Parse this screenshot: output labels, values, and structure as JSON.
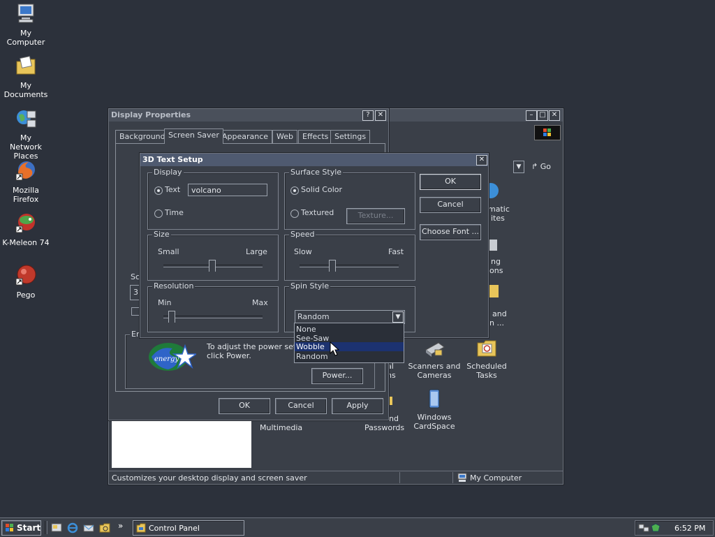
{
  "desktop": {
    "icons": [
      {
        "label": "My Computer"
      },
      {
        "label": "My Documents"
      },
      {
        "label": "My Network Places"
      },
      {
        "label": "Mozilla Firefox"
      },
      {
        "label": "K-Meleon 74"
      },
      {
        "label": "Pego"
      }
    ]
  },
  "control_panel": {
    "go_label": "Go",
    "items_partial": [
      "matic",
      "ites",
      "ng",
      "ons",
      "and",
      "n ..."
    ],
    "items": [
      {
        "label": "Scanners and Cameras"
      },
      {
        "label": "Scheduled Tasks"
      },
      {
        "label": "Windows CardSpace"
      }
    ],
    "partial_labels": [
      "al",
      "ns",
      "nd",
      "Passwords",
      "Multimedia"
    ],
    "status_text": "Customizes your desktop display and screen saver",
    "status_zone": "My Computer"
  },
  "display_properties": {
    "title": "Display Properties",
    "help_glyph": "?",
    "close_glyph": "✕",
    "tabs": [
      "Background",
      "Screen Saver",
      "Appearance",
      "Web",
      "Effects",
      "Settings"
    ],
    "screensaver_group_partial": "Sc",
    "screensaver_combo_partial": "3I",
    "energy_group_partial": "En",
    "energy_text_line1": "To adjust the power setting",
    "energy_text_line2": "click Power.",
    "power_button": "Power...",
    "ok": "OK",
    "cancel": "Cancel",
    "apply": "Apply"
  },
  "setup_dialog": {
    "title": "3D Text Setup",
    "close_glyph": "✕",
    "display_group": "Display",
    "text_radio": "Text",
    "text_value": "volcano",
    "time_radio": "Time",
    "surface_group": "Surface Style",
    "solid_color": "Solid Color",
    "textured": "Textured",
    "texture_button": "Texture...",
    "size_group": "Size",
    "size_small": "Small",
    "size_large": "Large",
    "speed_group": "Speed",
    "speed_slow": "Slow",
    "speed_fast": "Fast",
    "resolution_group": "Resolution",
    "res_min": "Min",
    "res_max": "Max",
    "spin_group": "Spin Style",
    "spin_selected": "Random",
    "spin_options": [
      "None",
      "See-Saw",
      "Wobble",
      "Random"
    ],
    "spin_highlighted": "Wobble",
    "ok": "OK",
    "cancel": "Cancel",
    "choose_font": "Choose Font ..."
  },
  "taskbar": {
    "start": "Start",
    "task": "Control Panel",
    "clock": "6:52 PM",
    "chevron": "»"
  },
  "colors": {
    "desktop": "#2c313b",
    "window": "#3a3f48",
    "highlight": "#1c3270",
    "dropdown_bg": "#2a2f38"
  }
}
